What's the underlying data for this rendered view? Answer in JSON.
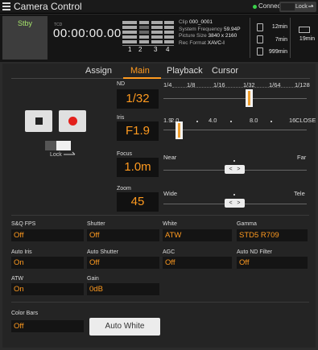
{
  "app": {
    "title": "Camera Control",
    "connection": "Connected",
    "lock_label": "Lock"
  },
  "colors": {
    "accent": "#ff9a1f",
    "connected": "#3ad14a",
    "stby": "#a6e36b",
    "rec": "#e3201b"
  },
  "status": {
    "state": "Stby",
    "tc_label": "TCD",
    "timecode": "00:00:00.00",
    "audio_channels": [
      "1",
      "2",
      "3",
      "4"
    ],
    "clip_label": "Clip",
    "clip_value": "000_0001",
    "sysfreq_label": "System Frequency",
    "sysfreq_value": "59.94P",
    "picsize_label": "Picture Size",
    "picsize_value": "3840 x 2160",
    "recformat_label": "Rec Format",
    "recformat_value": "XAVC-I",
    "media_a": "12min",
    "media_b": "7min",
    "media_c": "999min",
    "battery": "19min"
  },
  "tabs": [
    "Assign",
    "Main",
    "Playback",
    "Cursor"
  ],
  "controls": {
    "lock_label": "Lock",
    "nd": {
      "label": "ND",
      "value": "1/32",
      "scale": [
        "1/4",
        "1/8",
        "1/16",
        "1/32",
        "1/64",
        "1/128"
      ]
    },
    "iris": {
      "label": "Iris",
      "value": "F1.9",
      "scale": [
        "1.9",
        "2.0",
        "4.0",
        "8.0",
        "16",
        "CLOSE"
      ]
    },
    "focus": {
      "label": "Focus",
      "value": "1.0m",
      "near": "Near",
      "far": "Far"
    },
    "zoom": {
      "label": "Zoom",
      "value": "45",
      "wide": "Wide",
      "tele": "Tele"
    },
    "stepper_left": "<",
    "stepper_right": ">"
  },
  "settings": {
    "sq_fps": {
      "label": "S&Q FPS",
      "value": "Off"
    },
    "shutter": {
      "label": "Shutter",
      "value": "Off"
    },
    "white": {
      "label": "White",
      "value": "ATW"
    },
    "gamma": {
      "label": "Gamma",
      "value": "STD5 R709"
    },
    "auto_iris": {
      "label": "Auto Iris",
      "value": "On"
    },
    "auto_shutter": {
      "label": "Auto Shutter",
      "value": "Off"
    },
    "agc": {
      "label": "AGC",
      "value": "Off"
    },
    "auto_nd": {
      "label": "Auto ND Filter",
      "value": "Off"
    },
    "atw": {
      "label": "ATW",
      "value": "On"
    },
    "gain": {
      "label": "Gain",
      "value": "0dB"
    },
    "color_bars": {
      "label": "Color Bars",
      "value": "Off"
    },
    "auto_white_button": "Auto White"
  }
}
